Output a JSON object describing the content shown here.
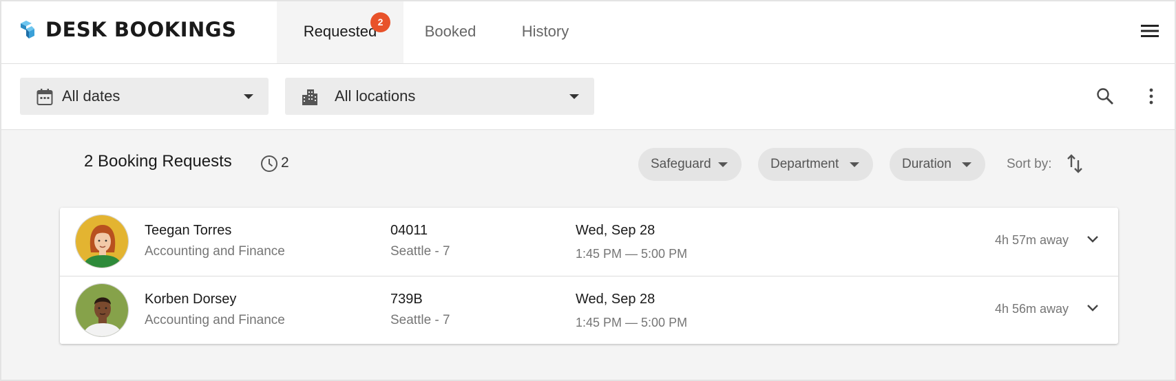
{
  "app": {
    "title": "DESK BOOKINGS"
  },
  "tabs": [
    {
      "label": "Requested",
      "badge": "2",
      "active": true
    },
    {
      "label": "Booked",
      "active": false
    },
    {
      "label": "History",
      "active": false
    }
  ],
  "filters": {
    "dates": {
      "value": "All dates",
      "icon": "calendar-icon"
    },
    "locations": {
      "value": "All locations",
      "icon": "building-icon"
    }
  },
  "summary": {
    "title": "2 Booking Requests",
    "pending_count": "2",
    "chips": [
      "Safeguard",
      "Department",
      "Duration"
    ],
    "sort_label": "Sort by:"
  },
  "requests": [
    {
      "name": "Teegan Torres",
      "department": "Accounting and Finance",
      "desk": "04011",
      "location": "Seattle - 7",
      "date": "Wed, Sep 28",
      "time": "1:45 PM — 5:00 PM",
      "away": "4h 57m away"
    },
    {
      "name": "Korben Dorsey",
      "department": "Accounting and Finance",
      "desk": "739B",
      "location": "Seattle - 7",
      "date": "Wed, Sep 28",
      "time": "1:45 PM — 5:00 PM",
      "away": "4h 56m away"
    }
  ],
  "colors": {
    "accent_badge": "#e8522a",
    "logo_blue": "#3aa0d8",
    "chip_bg": "#e4e4e4",
    "page_bg": "#f4f4f4"
  }
}
